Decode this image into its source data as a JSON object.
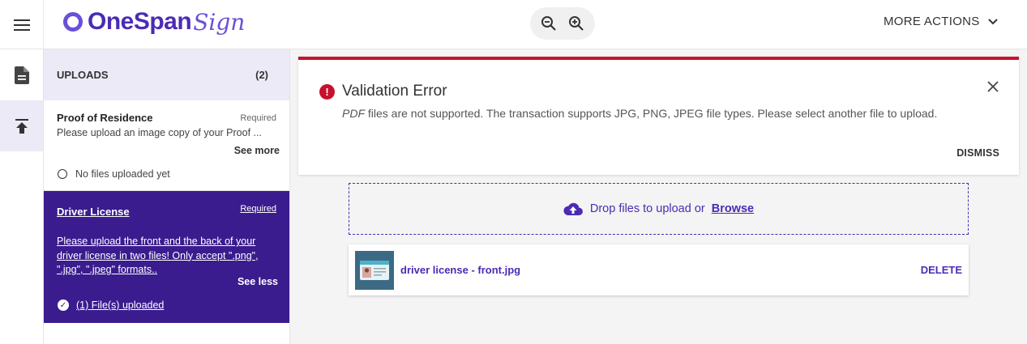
{
  "header": {
    "logo_text": "OneSpan",
    "logo_script": "Sign",
    "more_actions": "MORE ACTIONS",
    "icons": [
      "menu-icon",
      "zoom-out-icon",
      "zoom-in-icon",
      "chevron-down-icon"
    ]
  },
  "rail": {
    "icons": [
      "document-icon",
      "upload-icon"
    ]
  },
  "uploads": {
    "heading": "UPLOADS",
    "count": "(2)",
    "items": [
      {
        "title": "Proof of Residence",
        "required": "Required",
        "description": "Please upload an image copy of your Proof ...",
        "toggle": "See more",
        "status": "No files uploaded yet"
      },
      {
        "title": "Driver License",
        "required": "Required",
        "description": "Please upload the front and the back of your driver license in two files! Only accept \".png\", \".jpg\", \".jpeg\" formats..",
        "toggle": "See less",
        "status": "(1) File(s) uploaded"
      }
    ]
  },
  "error": {
    "title": "Validation Error",
    "message_em": "PDF",
    "message": " files are not supported. The transaction supports JPG, PNG, JPEG file types. Please select another file to upload.",
    "dismiss": "DISMISS"
  },
  "dropzone": {
    "text": "Drop files to upload or",
    "browse": "Browse"
  },
  "file": {
    "name": "driver license - front.jpg",
    "delete": "DELETE"
  },
  "colors": {
    "brand": "#4b2bb5",
    "active_panel": "#3a1c8e",
    "error": "#c8102e"
  }
}
